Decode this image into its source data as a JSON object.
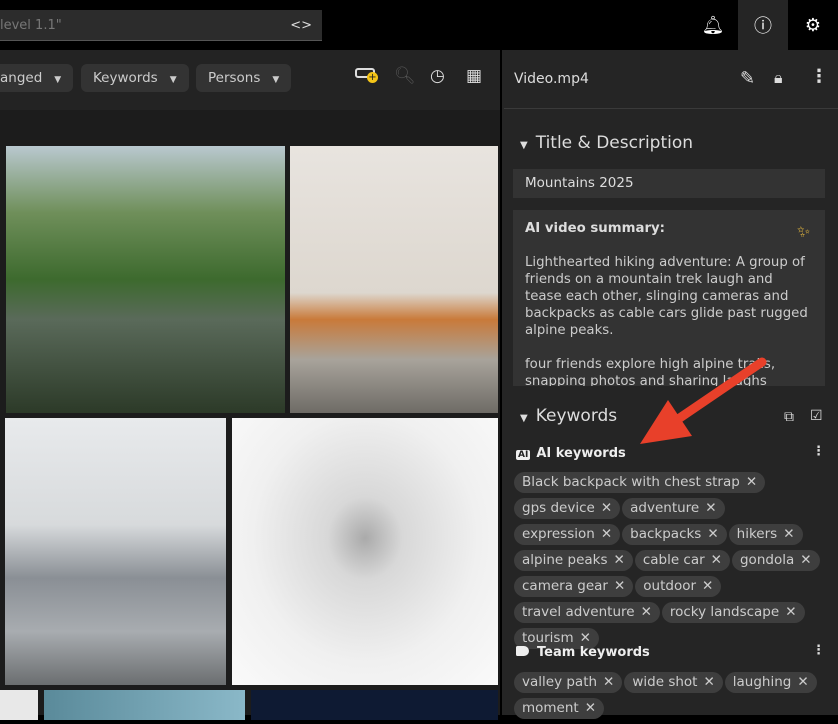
{
  "search": {
    "value": "level 1.1\"",
    "code_icon": "<>"
  },
  "topbar": {
    "icons": [
      "bell-icon",
      "info-icon",
      "gear-icon"
    ]
  },
  "filters": [
    {
      "label": "anged"
    },
    {
      "label": "Keywords"
    },
    {
      "label": "Persons"
    }
  ],
  "toolbar_icons": [
    "add-collection-icon",
    "zoom-icon",
    "clock-icon",
    "grid-view-icon"
  ],
  "panel": {
    "filename": "Video.mp4",
    "title_section": "Title & Description",
    "title_value": "Mountains 2025",
    "summary_label": "AI video summary:",
    "summary_p1": "Lighthearted hiking adventure: A group of friends on a mountain trek laugh and tease each other, slinging cameras and backpacks as cable cars glide past rugged alpine peaks.",
    "summary_p2": "four friends explore high alpine trails, snapping photos and sharing laughs",
    "keywords_section": "Keywords",
    "ai_group": "AI keywords",
    "ai_keywords": [
      "Black backpack with chest strap",
      "gps device",
      "adventure",
      "expression",
      "backpacks",
      "hikers",
      "alpine peaks",
      "cable car",
      "gondola",
      "camera gear",
      "outdoor",
      "travel adventure",
      "rocky landscape",
      "tourism"
    ],
    "team_group": "Team keywords",
    "team_keywords": [
      "valley path",
      "wide shot",
      "laughing",
      "moment"
    ]
  },
  "colors": {
    "accent_arrow": "#e8402a",
    "sparkle": "#f0c040",
    "add_badge": "#f5c518"
  }
}
